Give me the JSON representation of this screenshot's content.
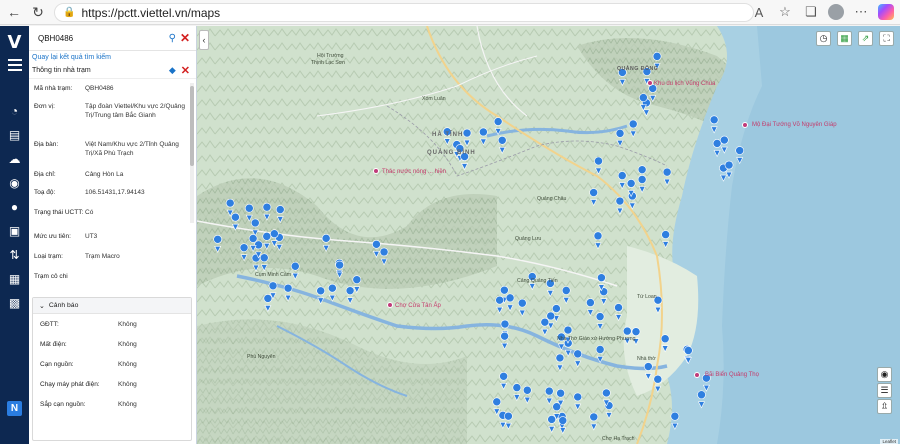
{
  "browser": {
    "url": "https://pctt.viettel.vn/maps",
    "back_icon": "back-arrow-icon",
    "refresh_icon": "refresh-icon",
    "lock_icon": "lock-icon"
  },
  "app": {
    "logo": "V",
    "nav_badge": "N",
    "nav_icons": [
      "dashboard-icon",
      "map-icon",
      "weather-icon",
      "bulb-icon",
      "station-icon",
      "briefcase-icon",
      "route-icon",
      "report-icon",
      "list-icon"
    ]
  },
  "panel": {
    "search_value": "QBH0486",
    "back_link": "Quay lại kết quả tìm kiếm",
    "info_title": "Thông tin nhà trạm",
    "details": [
      {
        "key": "Mã nhà trạm:",
        "value": "QBH0486"
      },
      {
        "key": "Đơn vị:",
        "value": "Tập đoàn Viettel/Khu vực 2/Quảng Trị/Trung tâm Bắc Gianh"
      },
      {
        "key": "Địa bàn:",
        "value": "Việt Nam/Khu vực 2/Tỉnh Quảng Trị/Xã Phù Trạch"
      },
      {
        "key": "Địa chỉ:",
        "value": "Cảng Hòn La"
      },
      {
        "key": "Toạ độ:",
        "value": "106.51431,17.94143"
      },
      {
        "key": "Trạng thái UCTT:",
        "value": "Có"
      },
      {
        "key": "Mức ưu tiên:",
        "value": "UT3"
      },
      {
        "key": "Loại trạm:",
        "value": "Trạm Macro"
      },
      {
        "key": "Trạm cô chi",
        "value": ""
      }
    ],
    "warning": {
      "title": "Cảnh báo",
      "rows": [
        {
          "key": "GĐTT:",
          "value": "Không"
        },
        {
          "key": "Mất điện:",
          "value": "Không"
        },
        {
          "key": "Cạn nguồn:",
          "value": "Không"
        },
        {
          "key": "Chạy máy phát điện:",
          "value": "Không"
        },
        {
          "key": "Sắp cạn nguồn:",
          "value": "Không"
        }
      ]
    }
  },
  "map": {
    "labels": [
      {
        "text": "Hội Trường",
        "kind": "normal"
      },
      {
        "text": "Thịnh Lạc Sơn",
        "kind": "normal"
      },
      {
        "text": "HÀ TĨNH",
        "kind": "prov"
      },
      {
        "text": "QUẢNG BÌNH",
        "kind": "prov"
      },
      {
        "text": "QUẢNG ĐÔNG",
        "kind": "bold"
      },
      {
        "text": "Khu du lịch Vũng Chùa",
        "kind": "pink"
      },
      {
        "text": "Mộ Đại Tướng Võ Nguyên Giáp",
        "kind": "pink"
      },
      {
        "text": "Thác nước nóng ... hiền",
        "kind": "pink"
      },
      {
        "text": "Chợ Cửa Tân Ấp",
        "kind": "pink"
      },
      {
        "text": "Cụm Minh Cầm",
        "kind": "normal"
      },
      {
        "text": "Cảng Quảng Tiến",
        "kind": "normal"
      },
      {
        "text": "Nhà Thờ Giáo xứ Hướng Phương",
        "kind": "normal"
      },
      {
        "text": "Tứ Loan",
        "kind": "normal"
      },
      {
        "text": "Bãi Biển Quảng Thọ",
        "kind": "pink"
      },
      {
        "text": "Phú Nguyên",
        "kind": "normal"
      },
      {
        "text": "Chợ Hạ Trạch",
        "kind": "normal"
      },
      {
        "text": "Nhà thờ",
        "kind": "normal"
      },
      {
        "text": "Xóm Luân",
        "kind": "normal"
      },
      {
        "text": "Quảng Châu",
        "kind": "normal"
      },
      {
        "text": "Quảng Lưu",
        "kind": "normal"
      }
    ],
    "attribution": "Leaflet",
    "tools_top": [
      "clock-icon",
      "layers-green-icon",
      "route-icon",
      "fullscreen-icon"
    ],
    "tools_bottom": [
      "location-icon",
      "stack-icon",
      "export-icon"
    ],
    "colors": {
      "land": "#d6e7d6",
      "mountain": "#c7d7c2",
      "sea": "#a8cfe0",
      "river": "#8fb8e0",
      "marker": "#2f7fe0"
    }
  }
}
